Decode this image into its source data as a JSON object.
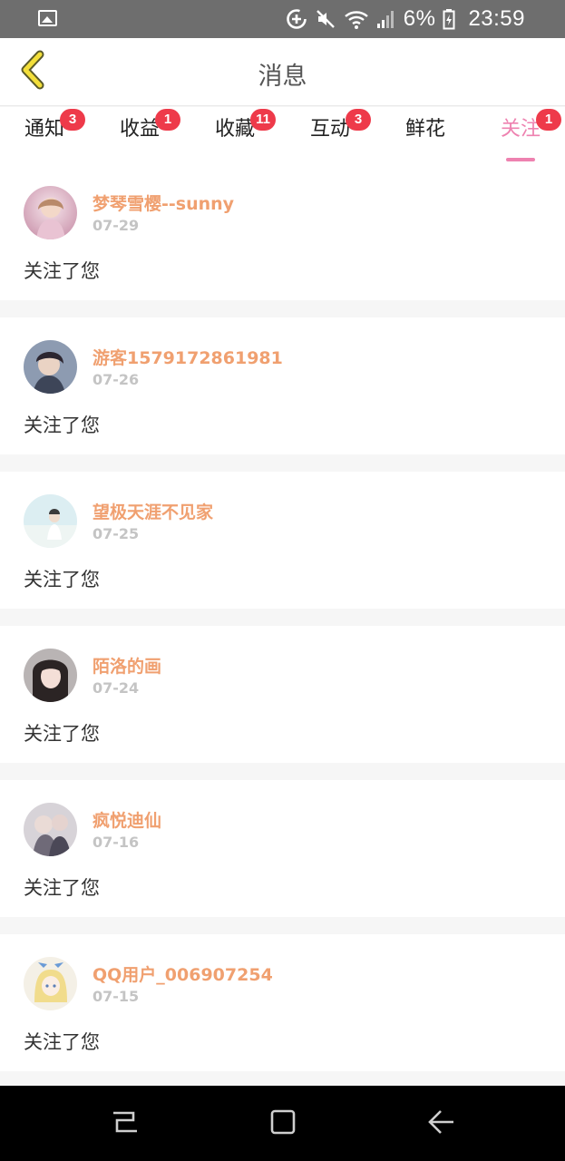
{
  "status_bar": {
    "battery_percent": "6%",
    "time": "23:59",
    "icons": [
      "gallery-icon",
      "data-saver-icon",
      "mute-icon",
      "wifi-icon",
      "signal-icon",
      "battery-icon"
    ]
  },
  "header": {
    "title": "消息"
  },
  "tabs": [
    {
      "label": "通知",
      "badge": "3"
    },
    {
      "label": "收益",
      "badge": "1"
    },
    {
      "label": "收藏",
      "badge": "11"
    },
    {
      "label": "互动",
      "badge": "3"
    },
    {
      "label": "鲜花",
      "badge": ""
    },
    {
      "label": "关注",
      "badge": "1",
      "active": true
    }
  ],
  "items": [
    {
      "name": "梦琴雪樱--sunny",
      "date": "07-29",
      "message": "关注了您"
    },
    {
      "name": "游客1579172861981",
      "date": "07-26",
      "message": "关注了您"
    },
    {
      "name": "望极天涯不见家",
      "date": "07-25",
      "message": "关注了您"
    },
    {
      "name": "陌洛的画",
      "date": "07-24",
      "message": "关注了您"
    },
    {
      "name": "疯悦迪仙",
      "date": "07-16",
      "message": "关注了您"
    },
    {
      "name": "QQ用户_006907254",
      "date": "07-15",
      "message": "关注了您"
    }
  ],
  "colors": {
    "accent": "#ee82b0",
    "badge": "#ee3a4a",
    "username": "#f0a070",
    "back_arrow": "#f3df3a"
  }
}
